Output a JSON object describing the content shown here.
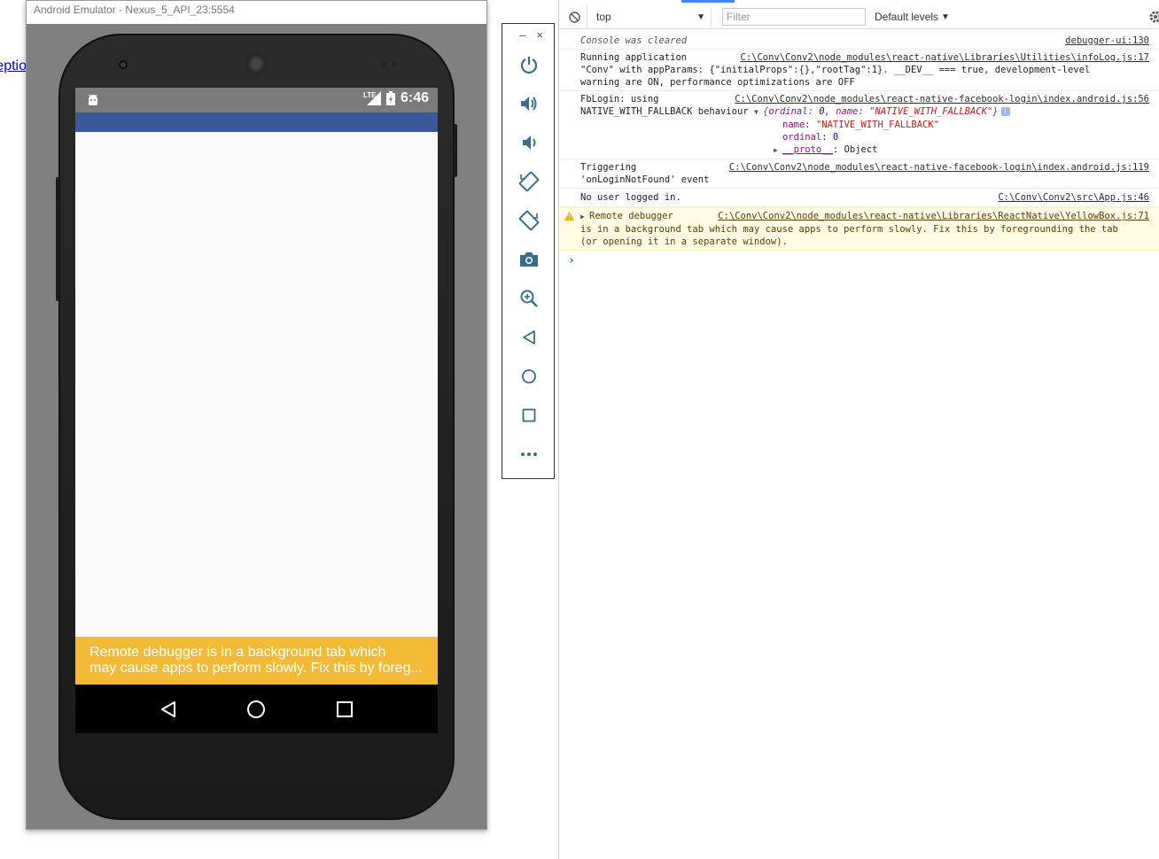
{
  "edge_link": {
    "text": "eptio"
  },
  "emulator": {
    "title": "Android Emulator - Nexus_5_API_23:5554",
    "status_time": "6:46",
    "network_label": "LTE",
    "yellowbox_line1": "Remote debugger is in a background tab which",
    "yellowbox_line2": "may cause apps to perform slowly. Fix this by foreg...",
    "appbar_color": "#3b5998",
    "warning_color": "#f3bb35",
    "nav": [
      "back-icon",
      "home-icon",
      "recents-icon"
    ]
  },
  "emu_toolbar": {
    "minimize_label": "–",
    "close_label": "×",
    "buttons": [
      "power-icon",
      "volume-up-icon",
      "volume-down-icon",
      "rotate-left-icon",
      "rotate-right-icon",
      "camera-icon",
      "zoom-icon",
      "back-icon",
      "home-icon",
      "overview-icon",
      "more-icon"
    ]
  },
  "devtools": {
    "context": "top",
    "filter_placeholder": "Filter",
    "levels": "Default levels",
    "messages": {
      "cleared": {
        "text": "Console was cleared",
        "src": "debugger-ui:130"
      },
      "running": {
        "line1": "Running application",
        "line2": "\"Conv\" with appParams: {\"initialProps\":{},\"rootTag\":1}. __DEV__ === true, development-level",
        "line3": "warning are ON, performance optimizations are OFF",
        "src": "C:\\Conv\\Conv2\\node_modules\\react-native\\Libraries\\Utilities\\infoLog.js:17"
      },
      "fblogin": {
        "line1": "FbLogin: using",
        "line2": "NATIVE_WITH_FALLBACK behaviour",
        "obj_summary_open": "{",
        "k_ordinal": "ordinal",
        "v_ordinal": "0",
        "k_name": "name",
        "v_name": "\"NATIVE_WITH_FALLBACK\"",
        "obj_summary_close": "}",
        "prop_name_key": "name",
        "prop_name_val": "\"NATIVE_WITH_FALLBACK\"",
        "prop_ordinal_key": "ordinal",
        "prop_ordinal_val": "0",
        "proto_key": "__proto__",
        "proto_val": "Object",
        "src": "C:\\Conv\\Conv2\\node_modules\\react-native-facebook-login\\index.android.js:56"
      },
      "triggering": {
        "line1": "Triggering",
        "line2": "'onLoginNotFound' event",
        "src": "C:\\Conv\\Conv2\\node_modules\\react-native-facebook-login\\index.android.js:119"
      },
      "nouser": {
        "text": "No user logged in.",
        "src": "C:\\Conv\\Conv2\\src\\App.js:46"
      },
      "warning": {
        "line1": "Remote debugger",
        "line2": "is in a background tab which may cause apps to perform slowly. Fix this by foregrounding the tab",
        "line3": "(or opening it in a separate window).",
        "src": "C:\\Conv\\Conv2\\node_modules\\react-native\\Libraries\\ReactNative\\YellowBox.js:71"
      }
    },
    "prompt": "›"
  }
}
